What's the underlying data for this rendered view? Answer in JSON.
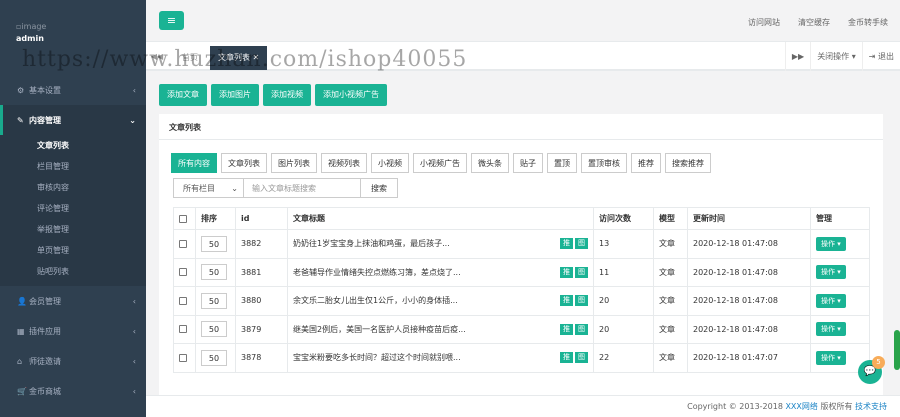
{
  "sidebar": {
    "logo_alt": "image",
    "user": "admin",
    "top": [
      {
        "icon": "⚙",
        "label": "基本设置"
      }
    ],
    "content_menu": {
      "icon": "✎",
      "label": "内容管理",
      "items": [
        "文章列表",
        "栏目管理",
        "审核内容",
        "评论管理",
        "举报管理",
        "单页管理",
        "贴吧列表"
      ]
    },
    "bottom": [
      {
        "icon": "👤",
        "label": "会员管理"
      },
      {
        "icon": "▦",
        "label": "插件应用"
      },
      {
        "icon": "⌂",
        "label": "师徒邀请"
      },
      {
        "icon": "🛒",
        "label": "金币商城"
      }
    ]
  },
  "topbar": {
    "links": [
      "访问网站",
      "清空缓存",
      "金币转手续"
    ]
  },
  "tabsbar": {
    "back": "◀◀",
    "tab1": "首页",
    "tab2": "文章列表 ✕",
    "fwd": "▶▶",
    "close_ops": "关闭操作 ▾",
    "logout": "⇥ 退出"
  },
  "actions": [
    "添加文章",
    "添加图片",
    "添加视频",
    "添加小视频广告"
  ],
  "panel": {
    "title": "文章列表",
    "filter_tabs": [
      "所有内容",
      "文章列表",
      "图片列表",
      "视频列表",
      "小视频",
      "小视频广告",
      "微头条",
      "贴子",
      "置顶",
      "置顶审核",
      "推荐",
      "搜索推荐"
    ],
    "select_label": "所有栏目",
    "search_placeholder": "输入文章标题搜索",
    "search_btn": "搜索"
  },
  "table": {
    "headers": [
      "排序",
      "id",
      "文章标题",
      "访问次数",
      "模型",
      "更新时间",
      "管理"
    ],
    "tag1": "推",
    "tag2": "图",
    "op": "操作 ▾",
    "rows": [
      {
        "sort": "50",
        "id": "3882",
        "title": "奶奶往1岁宝宝身上抹油和鸡蛋，最后孩子...",
        "visits": "13",
        "model": "文章",
        "time": "2020-12-18 01:47:08"
      },
      {
        "sort": "50",
        "id": "3881",
        "title": "老爸辅导作业情绪失控点燃练习簿，差点烧了...",
        "visits": "11",
        "model": "文章",
        "time": "2020-12-18 01:47:08"
      },
      {
        "sort": "50",
        "id": "3880",
        "title": "余文乐二胎女儿出生仅1公斤，小小的身体插...",
        "visits": "20",
        "model": "文章",
        "time": "2020-12-18 01:47:08"
      },
      {
        "sort": "50",
        "id": "3879",
        "title": "继美国2例后，美国一名医护人员接种疫苗后疫...",
        "visits": "20",
        "model": "文章",
        "time": "2020-12-18 01:47:08"
      },
      {
        "sort": "50",
        "id": "3878",
        "title": "宝宝米粉要吃多长时间？超过这个时间就别喂...",
        "visits": "22",
        "model": "文章",
        "time": "2020-12-18 01:47:07"
      }
    ]
  },
  "footer": {
    "text": "Copyright © 2013-2018",
    "site": "XXX网络",
    "rights": "版权所有",
    "support": "技术支持"
  },
  "chat_count": "5",
  "watermark": "https://www.huzhan.com/ishop40055"
}
